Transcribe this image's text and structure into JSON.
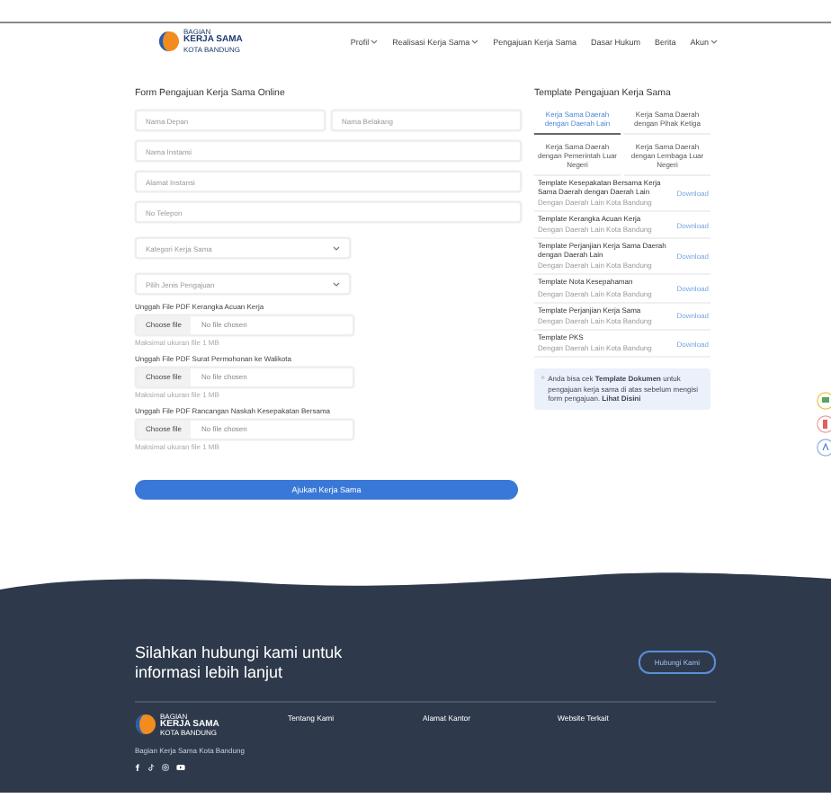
{
  "header": {
    "logo_lines": [
      "BAGIAN",
      "KERJA SAMA",
      "KOTA BANDUNG"
    ],
    "nav": [
      {
        "label": "Profil",
        "dropdown": true
      },
      {
        "label": "Realisasi Kerja Sama",
        "dropdown": true
      },
      {
        "label": "Pengajuan Kerja Sama",
        "dropdown": false
      },
      {
        "label": "Dasar Hukum",
        "dropdown": false
      },
      {
        "label": "Berita",
        "dropdown": false
      },
      {
        "label": "Akun",
        "dropdown": true
      }
    ]
  },
  "form": {
    "title": "Form Pengajuan Kerja Sama Online",
    "fields": [
      {
        "kind": "text",
        "placeholder": "Nama Depan",
        "half": true
      },
      {
        "kind": "text",
        "placeholder": "Nama Belakang",
        "half": true
      },
      {
        "kind": "text",
        "placeholder": "Nama Instansi",
        "half": false
      },
      {
        "kind": "text",
        "placeholder": "Alamat Instansi",
        "half": false
      },
      {
        "kind": "text",
        "placeholder": "No Telepon",
        "half": false
      },
      {
        "kind": "select",
        "placeholder": "Kategori Kerja Sama",
        "half": false
      },
      {
        "kind": "select",
        "placeholder": "Pilih Jenis Pengajuan",
        "half": false
      }
    ],
    "uploads": [
      {
        "label": "Unggah File PDF Kerangka Acuan Kerja",
        "button": "Choose file",
        "status": "No file chosen",
        "hint": "Maksimal ukuran file 1 MB"
      },
      {
        "label": "Unggah File PDF Surat Permohonan ke Walikota",
        "button": "Choose file",
        "status": "No file chosen",
        "hint": "Maksimal ukuran file 1 MB"
      },
      {
        "label": "Unggah File PDF Rancangan Naskah Kesepakatan Bersama",
        "button": "Choose file",
        "status": "No file chosen",
        "hint": "Maksimal ukuran file 1 MB"
      }
    ],
    "submit": "Ajukan Kerja Sama"
  },
  "templates": {
    "title": "Template Pengajuan Kerja Sama",
    "tabs": [
      {
        "label": "Kerja Sama Daerah dengan Daerah Lain",
        "selected": true
      },
      {
        "label": "Kerja Sama Daerah dengan Pihak Ketiga",
        "selected": false
      },
      {
        "label": "Kerja Sama Daerah dengan Pemerintah Luar Negeri",
        "selected": false
      },
      {
        "label": "Kerja Sama Daerah dengan Lembaga Luar Negeri",
        "selected": false
      }
    ],
    "items": [
      {
        "title": "Template Kesepakatan Bersama Kerja Sama Daerah dengan Daerah Lain",
        "subtitle": "Dengan Daerah Lain Kota Bandung",
        "action": "Download"
      },
      {
        "title": "Template Kerangka Acuan Kerja",
        "subtitle": "Dengan Daerah Lain Kota Bandung",
        "action": "Download"
      },
      {
        "title": "Template Perjanjian Kerja Sama Daerah dengan Daerah Lain",
        "subtitle": "Dengan Daerah Lain Kota Bandung",
        "action": "Download"
      },
      {
        "title": "Template Nota Kesepahaman",
        "subtitle": "Dengan Daerah Lain Kota Bandung",
        "action": "Download"
      },
      {
        "title": "Template Perjanjian Kerja Sama",
        "subtitle": "Dengan Daerah Lain Kota Bandung",
        "action": "Download"
      },
      {
        "title": "Template PKS",
        "subtitle": "Dengan Daerah Lain Kota Bandung",
        "action": "Download"
      }
    ],
    "note": "Anda bisa cek **Template Dokumen** untuk pengajuan kerja sama di atas sebelum mengisi form pengajuan. **Lihat Disini**"
  },
  "footer": {
    "heading": "Silahkan hubungi kami untuk informasi lebih lanjut",
    "contact_button": "Hubungi Kami",
    "logo_lines": [
      "BAGIAN",
      "KERJA SAMA",
      "KOTA BANDUNG"
    ],
    "tagline": "Bagian Kerja Sama Kota Bandung",
    "columns": [
      "Tentang Kami",
      "Alamat Kantor",
      "Website Terkait"
    ]
  }
}
